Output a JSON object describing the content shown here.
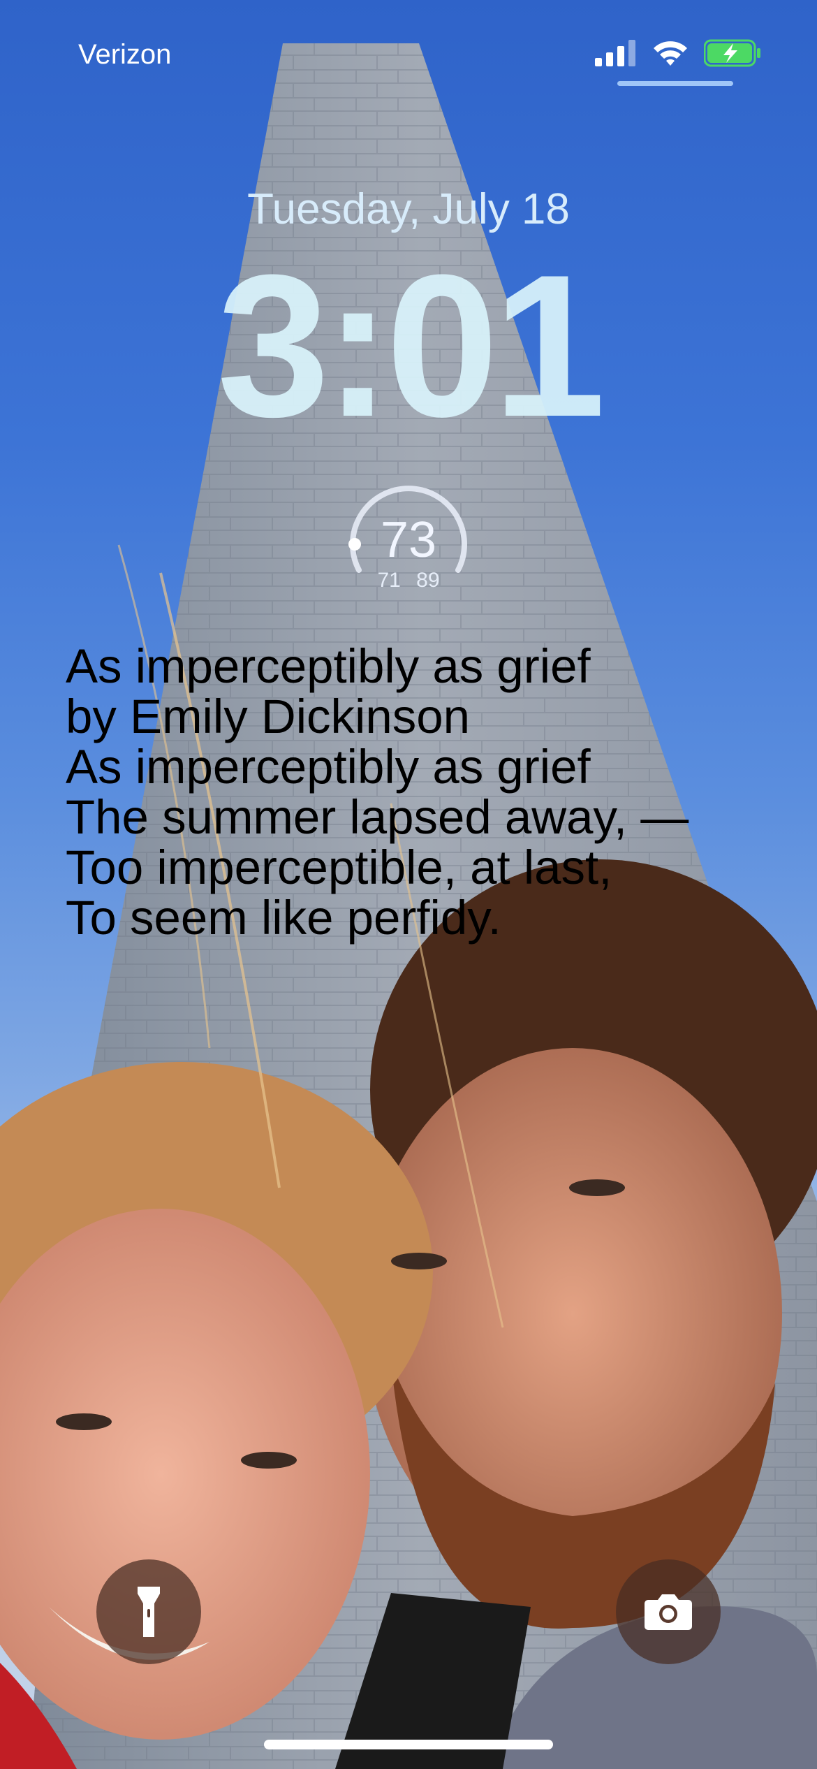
{
  "status_bar": {
    "carrier": "Verizon",
    "icons": [
      "cellular-signal-icon",
      "wifi-icon",
      "battery-charging-icon"
    ],
    "battery_color": "#4cd964"
  },
  "lock_screen": {
    "date": "Tuesday, July 18",
    "time": "3:01"
  },
  "weather_widget": {
    "current_temp": "73",
    "low_temp": "71",
    "high_temp": "89"
  },
  "poem_widget": {
    "lines": [
      "As imperceptibly as grief",
      "by Emily Dickinson",
      "As imperceptibly as grief",
      "The summer lapsed away, —",
      "Too imperceptible, at last,",
      "To seem like perfidy."
    ]
  },
  "bottom_controls": {
    "left_icon": "flashlight-icon",
    "right_icon": "camera-icon"
  }
}
